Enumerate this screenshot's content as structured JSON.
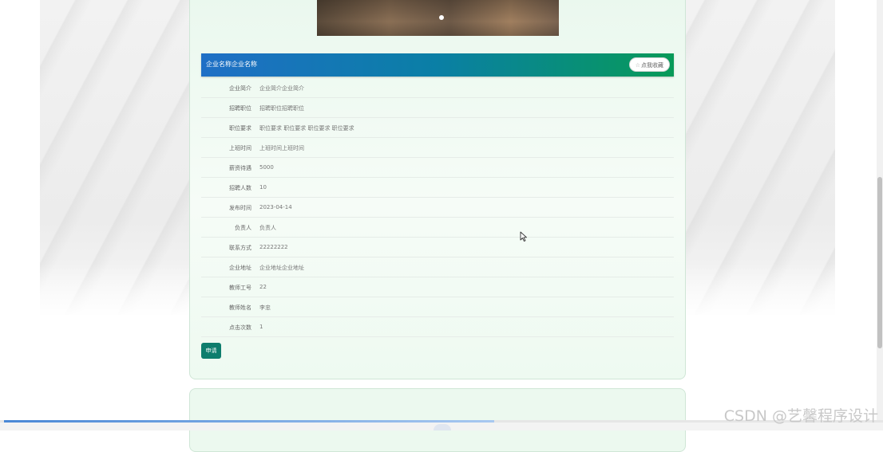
{
  "detail": {
    "company_title": "企业名称企业名称",
    "favorite_label": "点我收藏",
    "fields": [
      {
        "label": "企业简介",
        "value": "企业简介企业简介"
      },
      {
        "label": "招聘职位",
        "value": "招聘职位招聘职位"
      },
      {
        "label": "职位要求",
        "value": "职位要求 职位要求 职位要求 职位要求"
      },
      {
        "label": "上班时间",
        "value": "上班时间上班时间"
      },
      {
        "label": "薪资待遇",
        "value": "5000"
      },
      {
        "label": "招聘人数",
        "value": "10"
      },
      {
        "label": "发布时间",
        "value": "2023-04-14"
      },
      {
        "label": "负责人",
        "value": "负责人"
      },
      {
        "label": "联系方式",
        "value": "22222222"
      },
      {
        "label": "企业地址",
        "value": "企业地址企业地址"
      },
      {
        "label": "教师工号",
        "value": "22"
      },
      {
        "label": "教师姓名",
        "value": "李忠"
      },
      {
        "label": "点击次数",
        "value": "1"
      }
    ],
    "apply_label": "申请"
  },
  "carousel": {
    "active_index": 0,
    "dots": 1
  },
  "page_progress": 0.56,
  "watermark": "CSDN @艺馨程序设计",
  "colors": {
    "header_start": "#1f6fc6",
    "header_end": "#079a58",
    "apply_button": "#0e7d6d",
    "card_bg": "#eaf8ee"
  },
  "icons": [
    "star-icon",
    "cursor-icon"
  ]
}
